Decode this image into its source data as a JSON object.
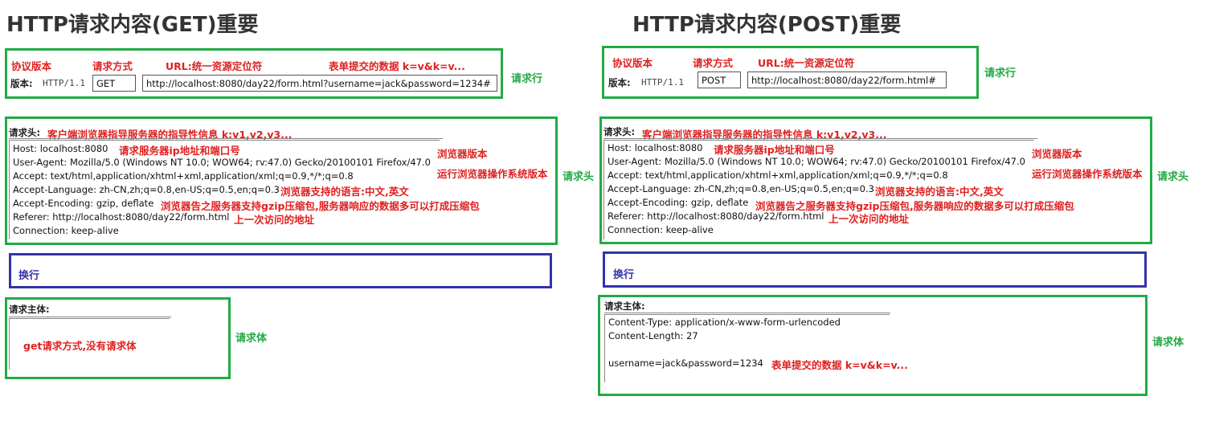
{
  "get": {
    "title": "HTTP请求内容(GET)重要",
    "request_line": {
      "label_version": "协议版本",
      "label_method": "请求方式",
      "label_url": "URL:统一资源定位符",
      "label_form": "表单提交的数据 k=v&k=v...",
      "version_prefix": "版本:",
      "version": "HTTP/1.1",
      "method": "GET",
      "url": "http://localhost:8080/day22/form.html?username=jack&password=1234#",
      "side_label": "请求行"
    },
    "headers": {
      "caption": "请求头:",
      "caption_note": "客户端浏览器指导服务器的指导性信息 k:v1,v2,v3...",
      "lines": [
        "Host: localhost:8080",
        "User-Agent: Mozilla/5.0 (Windows NT 10.0; WOW64; rv:47.0) Gecko/20100101 Firefox/47.0",
        "Accept: text/html,application/xhtml+xml,application/xml;q=0.9,*/*;q=0.8",
        "Accept-Language: zh-CN,zh;q=0.8,en-US;q=0.5,en;q=0.3",
        "Accept-Encoding: gzip, deflate",
        "Referer: http://localhost:8080/day22/form.html",
        "Connection: keep-alive"
      ],
      "notes": {
        "host": "请求服务器ip地址和端口号",
        "browser_version": "浏览器版本",
        "os_version": "运行浏览器操作系统版本",
        "language": "浏览器支持的语言:中文,英文",
        "encoding": "浏览器告之服务器支持gzip压缩包,服务器响应的数据多可以打成压缩包",
        "referer": "上一次访问的地址"
      },
      "side_label": "请求头"
    },
    "newline": {
      "label": "换行"
    },
    "body": {
      "caption": "请求主体:",
      "note": "get请求方式,没有请求体",
      "side_label": "请求体"
    }
  },
  "post": {
    "title": "HTTP请求内容(POST)重要",
    "request_line": {
      "label_version": "协议版本",
      "label_method": "请求方式",
      "label_url": "URL:统一资源定位符",
      "version_prefix": "版本:",
      "version": "HTTP/1.1",
      "method": "POST",
      "url": "http://localhost:8080/day22/form.html#",
      "side_label": "请求行"
    },
    "headers": {
      "caption": "请求头:",
      "caption_note": "客户端浏览器指导服务器的指导性信息 k:v1,v2,v3...",
      "lines": [
        "Host: localhost:8080",
        "User-Agent: Mozilla/5.0 (Windows NT 10.0; WOW64; rv:47.0) Gecko/20100101 Firefox/47.0",
        "Accept: text/html,application/xhtml+xml,application/xml;q=0.9,*/*;q=0.8",
        "Accept-Language: zh-CN,zh;q=0.8,en-US;q=0.5,en;q=0.3",
        "Accept-Encoding: gzip, deflate",
        "Referer: http://localhost:8080/day22/form.html",
        "Connection: keep-alive"
      ],
      "notes": {
        "host": "请求服务器ip地址和端口号",
        "browser_version": "浏览器版本",
        "os_version": "运行浏览器操作系统版本",
        "language": "浏览器支持的语言:中文,英文",
        "encoding": "浏览器告之服务器支持gzip压缩包,服务器响应的数据多可以打成压缩包",
        "referer": "上一次访问的地址"
      },
      "side_label": "请求头"
    },
    "newline": {
      "label": "换行"
    },
    "body": {
      "caption": "请求主体:",
      "lines": [
        "Content-Type: application/x-www-form-urlencoded",
        "Content-Length: 27",
        "",
        "username=jack&password=1234"
      ],
      "note": "表单提交的数据 k=v&k=v...",
      "side_label": "请求体"
    }
  }
}
